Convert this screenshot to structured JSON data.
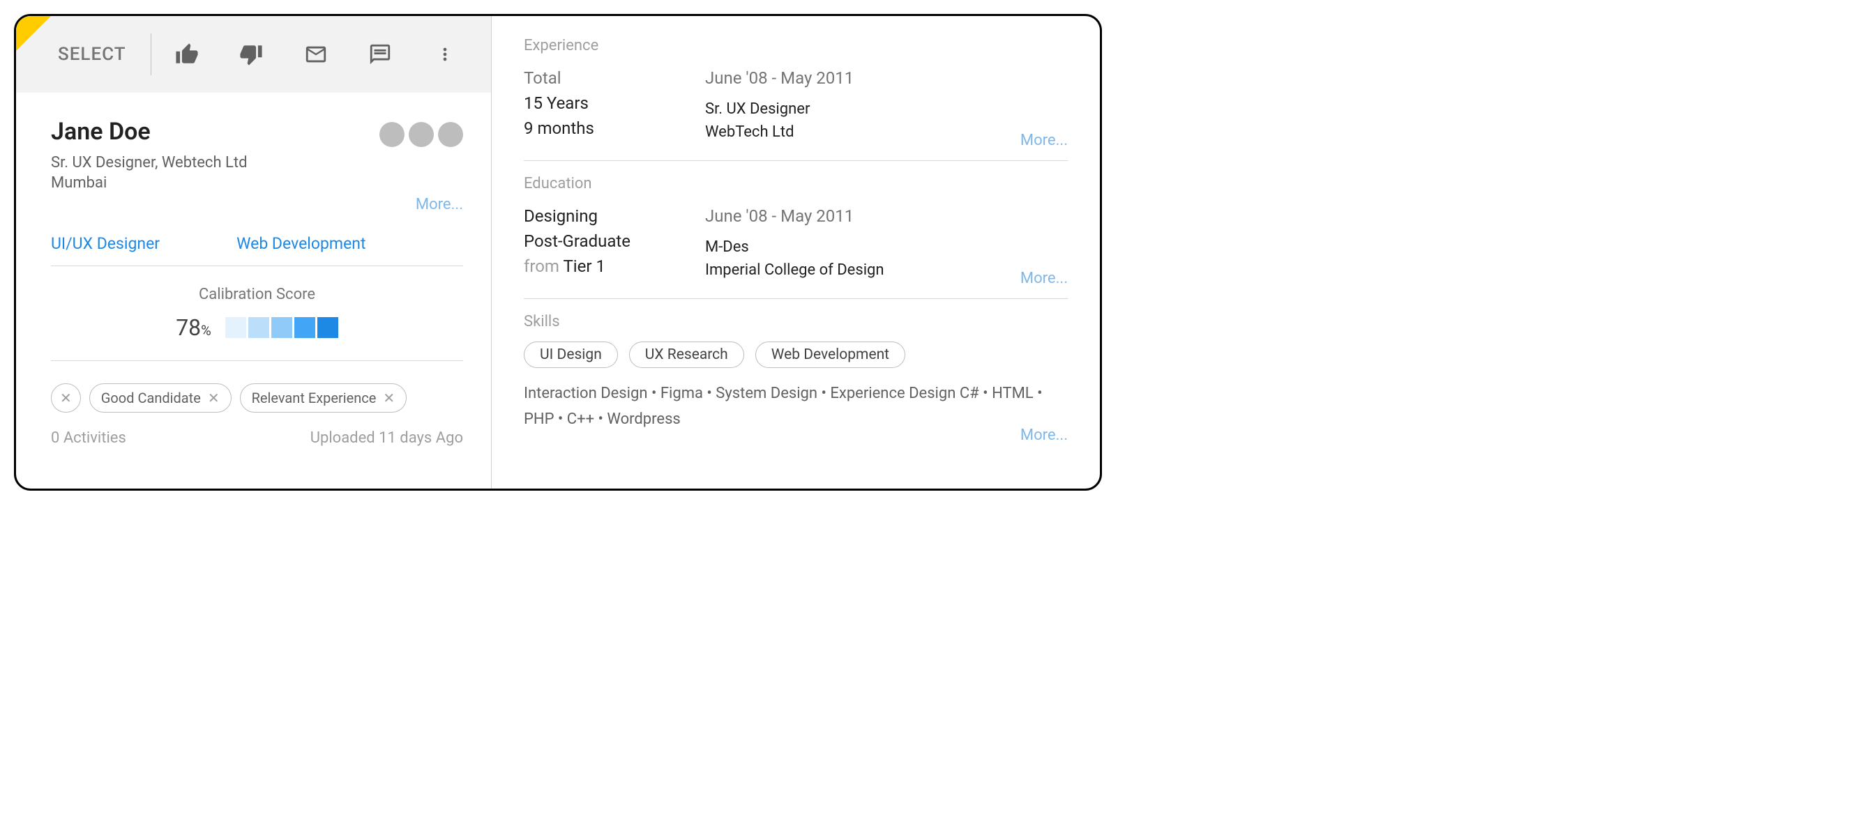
{
  "toolbar": {
    "select_label": "SELECT"
  },
  "profile": {
    "name": "Jane Doe",
    "title": "Sr. UX Designer, Webtech Ltd",
    "location": "Mumbai",
    "more_label": "More...",
    "tag1": "UI/UX Designer",
    "tag2": "Web Development"
  },
  "calibration": {
    "label": "Calibration Score",
    "score": "78",
    "percent": "%"
  },
  "chips": {
    "chip1": "Good Candidate",
    "chip2": "Relevant Experience"
  },
  "footer": {
    "activities": "0 Activities",
    "uploaded": "Uploaded 11 days Ago"
  },
  "experience": {
    "label": "Experience",
    "total_label": "Total",
    "years": "15 Years",
    "months": "9 months",
    "period": "June '08 - May 2011",
    "role": "Sr. UX Designer",
    "company": "WebTech Ltd",
    "more": "More..."
  },
  "education": {
    "label": "Education",
    "field": "Designing",
    "level": "Post-Graduate",
    "from_label": "from",
    "tier": "Tier 1",
    "period": "June '08 - May 2011",
    "degree": "M-Des",
    "institution": "Imperial College of Design",
    "more": "More..."
  },
  "skills": {
    "label": "Skills",
    "chip1": "UI Design",
    "chip2": "UX Research",
    "chip3": "Web Development",
    "list": "Interaction Design • Figma • System Design • Experience Design C# • HTML • PHP • C++ • Wordpress",
    "more": "More..."
  }
}
